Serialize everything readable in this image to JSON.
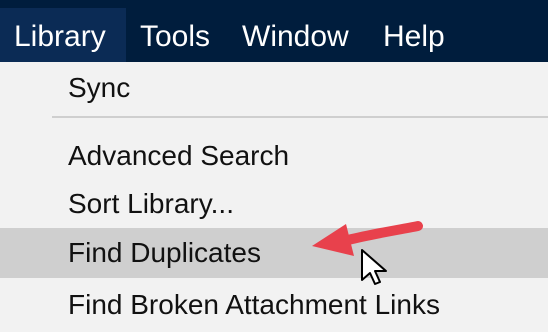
{
  "menubar": {
    "items": [
      {
        "label": "Library",
        "active": true
      },
      {
        "label": "Tools",
        "active": false
      },
      {
        "label": "Window",
        "active": false
      },
      {
        "label": "Help",
        "active": false
      }
    ]
  },
  "dropdown": {
    "items": [
      {
        "label": "Sync"
      },
      {
        "label": "Advanced Search"
      },
      {
        "label": "Sort Library..."
      },
      {
        "label": "Find Duplicates",
        "highlighted": true
      },
      {
        "label": "Find Broken Attachment Links"
      }
    ]
  },
  "colors": {
    "menubar_bg": "#001d3d",
    "menu_bg": "#f2f2f2",
    "highlight_bg": "#cfcfcf",
    "annotation_arrow": "#e8414c"
  },
  "icons": {
    "annotation": "red-arrow-icon",
    "pointer": "mouse-cursor-icon"
  }
}
